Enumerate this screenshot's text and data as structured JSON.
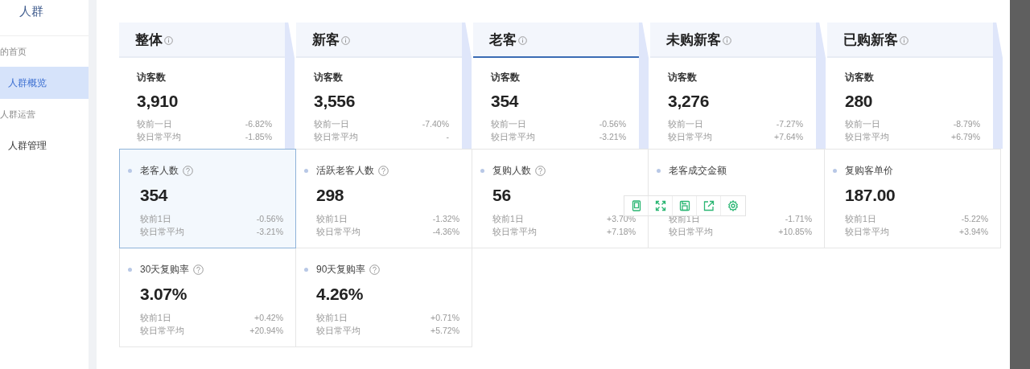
{
  "sidebar": {
    "title": "人群",
    "items": [
      {
        "label": "的首页",
        "kind": "section"
      },
      {
        "label": "人群概览",
        "kind": "item",
        "selected": true
      },
      {
        "label": "人群运营",
        "kind": "section"
      },
      {
        "label": "人群管理",
        "kind": "item",
        "selected": false
      }
    ]
  },
  "tabs": [
    {
      "label": "整体",
      "selected": false,
      "summary": {
        "label": "访客数",
        "value": "3,910",
        "rows": [
          {
            "label": "较前一日",
            "change": "-6.82%"
          },
          {
            "label": "较日常平均",
            "change": "-1.85%"
          }
        ]
      }
    },
    {
      "label": "新客",
      "selected": false,
      "summary": {
        "label": "访客数",
        "value": "3,556",
        "rows": [
          {
            "label": "较前一日",
            "change": "-7.40%"
          },
          {
            "label": "较日常平均",
            "change": "-"
          }
        ]
      }
    },
    {
      "label": "老客",
      "selected": true,
      "summary": {
        "label": "访客数",
        "value": "354",
        "rows": [
          {
            "label": "较前一日",
            "change": "-0.56%"
          },
          {
            "label": "较日常平均",
            "change": "-3.21%"
          }
        ]
      }
    },
    {
      "label": "未购新客",
      "selected": false,
      "summary": {
        "label": "访客数",
        "value": "3,276",
        "rows": [
          {
            "label": "较前一日",
            "change": "-7.27%"
          },
          {
            "label": "较日常平均",
            "change": "+7.64%"
          }
        ]
      }
    },
    {
      "label": "已购新客",
      "selected": false,
      "summary": {
        "label": "访客数",
        "value": "280",
        "rows": [
          {
            "label": "较前一日",
            "change": "-8.79%"
          },
          {
            "label": "较日常平均",
            "change": "+6.79%"
          }
        ]
      }
    }
  ],
  "metrics": [
    {
      "label": "老客人数",
      "help": true,
      "selected": true,
      "value": "354",
      "rows": [
        {
          "label": "较前1日",
          "change": "-0.56%"
        },
        {
          "label": "较日常平均",
          "change": "-3.21%"
        }
      ]
    },
    {
      "label": "活跃老客人数",
      "help": true,
      "selected": false,
      "value": "298",
      "rows": [
        {
          "label": "较前1日",
          "change": "-1.32%"
        },
        {
          "label": "较日常平均",
          "change": "-4.36%"
        }
      ]
    },
    {
      "label": "复购人数",
      "help": true,
      "selected": false,
      "value": "56",
      "rows": [
        {
          "label": "较前1日",
          "change": "+3.70%"
        },
        {
          "label": "较日常平均",
          "change": "+7.18%"
        }
      ]
    },
    {
      "label": "老客成交金额",
      "help": false,
      "selected": false,
      "rows": [
        {
          "label": "较前1日",
          "change": "-1.71%"
        },
        {
          "label": "较日常平均",
          "change": "+10.85%"
        }
      ]
    },
    {
      "label": "复购客单价",
      "help": false,
      "selected": false,
      "value": "187.00",
      "rows": [
        {
          "label": "较前1日",
          "change": "-5.22%"
        },
        {
          "label": "较日常平均",
          "change": "+3.94%"
        }
      ]
    },
    {
      "label": "30天复购率",
      "help": true,
      "selected": false,
      "value": "3.07%",
      "rows": [
        {
          "label": "较前1日",
          "change": "+0.42%"
        },
        {
          "label": "较日常平均",
          "change": "+20.94%"
        }
      ]
    },
    {
      "label": "90天复购率",
      "help": true,
      "selected": false,
      "value": "4.26%",
      "rows": [
        {
          "label": "较前1日",
          "change": "+0.71%"
        },
        {
          "label": "较日常平均",
          "change": "+5.72%"
        }
      ]
    }
  ]
}
